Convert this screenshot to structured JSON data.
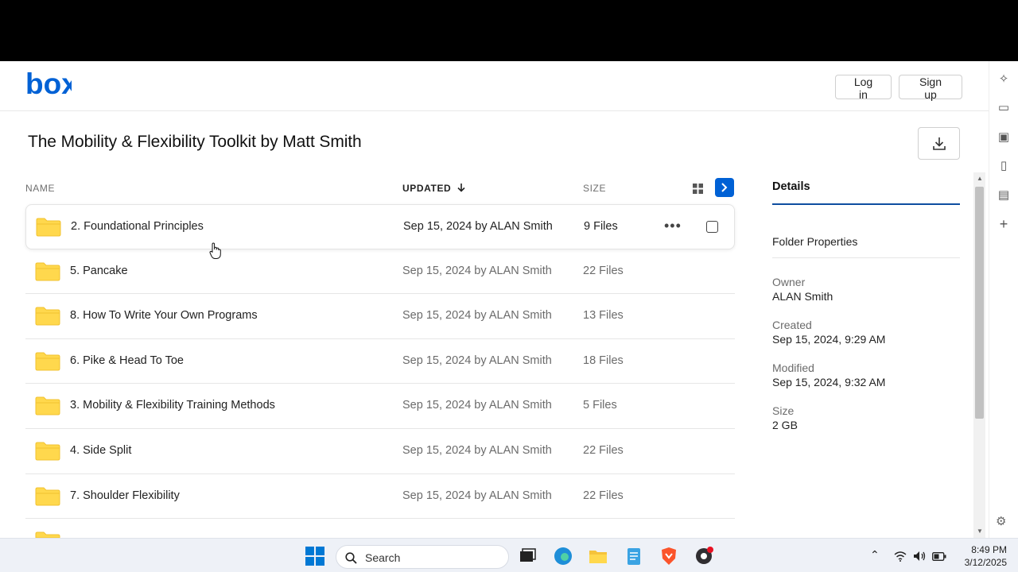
{
  "header": {
    "logo_text": "box",
    "login_label": "Log in",
    "signup_label": "Sign up"
  },
  "page_title": "The Mobility & Flexibility Toolkit by Matt Smith",
  "columns": {
    "name": "NAME",
    "updated": "UPDATED",
    "size": "SIZE"
  },
  "rows": [
    {
      "name": "2. Foundational Principles",
      "updated": "Sep 15, 2024 by ALAN Smith",
      "size": "9 Files"
    },
    {
      "name": "5. Pancake",
      "updated": "Sep 15, 2024 by ALAN Smith",
      "size": "22 Files"
    },
    {
      "name": "8. How To Write Your Own Programs",
      "updated": "Sep 15, 2024 by ALAN Smith",
      "size": "13 Files"
    },
    {
      "name": "6. Pike & Head To Toe",
      "updated": "Sep 15, 2024 by ALAN Smith",
      "size": "18 Files"
    },
    {
      "name": "3. Mobility & Flexibility Training Methods",
      "updated": "Sep 15, 2024 by ALAN Smith",
      "size": "5 Files"
    },
    {
      "name": "4. Side Split",
      "updated": "Sep 15, 2024 by ALAN Smith",
      "size": "22 Files"
    },
    {
      "name": "7. Shoulder Flexibility",
      "updated": "Sep 15, 2024 by ALAN Smith",
      "size": "22 Files"
    }
  ],
  "details": {
    "tab_label": "Details",
    "section_label": "Folder Properties",
    "owner_label": "Owner",
    "owner_value": "ALAN Smith",
    "created_label": "Created",
    "created_value": "Sep 15, 2024, 9:29 AM",
    "modified_label": "Modified",
    "modified_value": "Sep 15, 2024, 9:32 AM",
    "size_label": "Size",
    "size_value": "2 GB"
  },
  "taskbar": {
    "search_placeholder": "Search",
    "time": "8:49 PM",
    "date": "3/12/2025"
  },
  "colors": {
    "brand_blue": "#0061d5",
    "folder_yellow": "#ffd84d"
  }
}
